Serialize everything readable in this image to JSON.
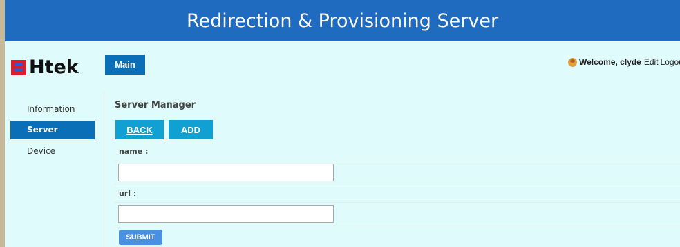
{
  "header": {
    "title": "Redirection & Provisioning Server"
  },
  "brand": {
    "logo_text": "Htek"
  },
  "top_nav": {
    "main_tab": "Main"
  },
  "user_bar": {
    "welcome_prefix": "Welcome,",
    "username": "clyde",
    "edit_label": "Edit",
    "logout_label": "Logou"
  },
  "sidebar": {
    "items": [
      {
        "label": "Information",
        "active": false
      },
      {
        "label": "Server",
        "active": true
      },
      {
        "label": "Device",
        "active": false
      }
    ]
  },
  "content": {
    "title": "Server Manager",
    "back_label": "BACK",
    "add_label": "ADD",
    "name_label": "name :",
    "name_value": "",
    "url_label": "url :",
    "url_value": "",
    "submit_label": "SUBMIT"
  },
  "colors": {
    "banner": "#1e6bc0",
    "active_nav": "#0b6fb8",
    "button": "#10a0d2",
    "submit": "#4a90e2",
    "background": "#dffbfc"
  }
}
